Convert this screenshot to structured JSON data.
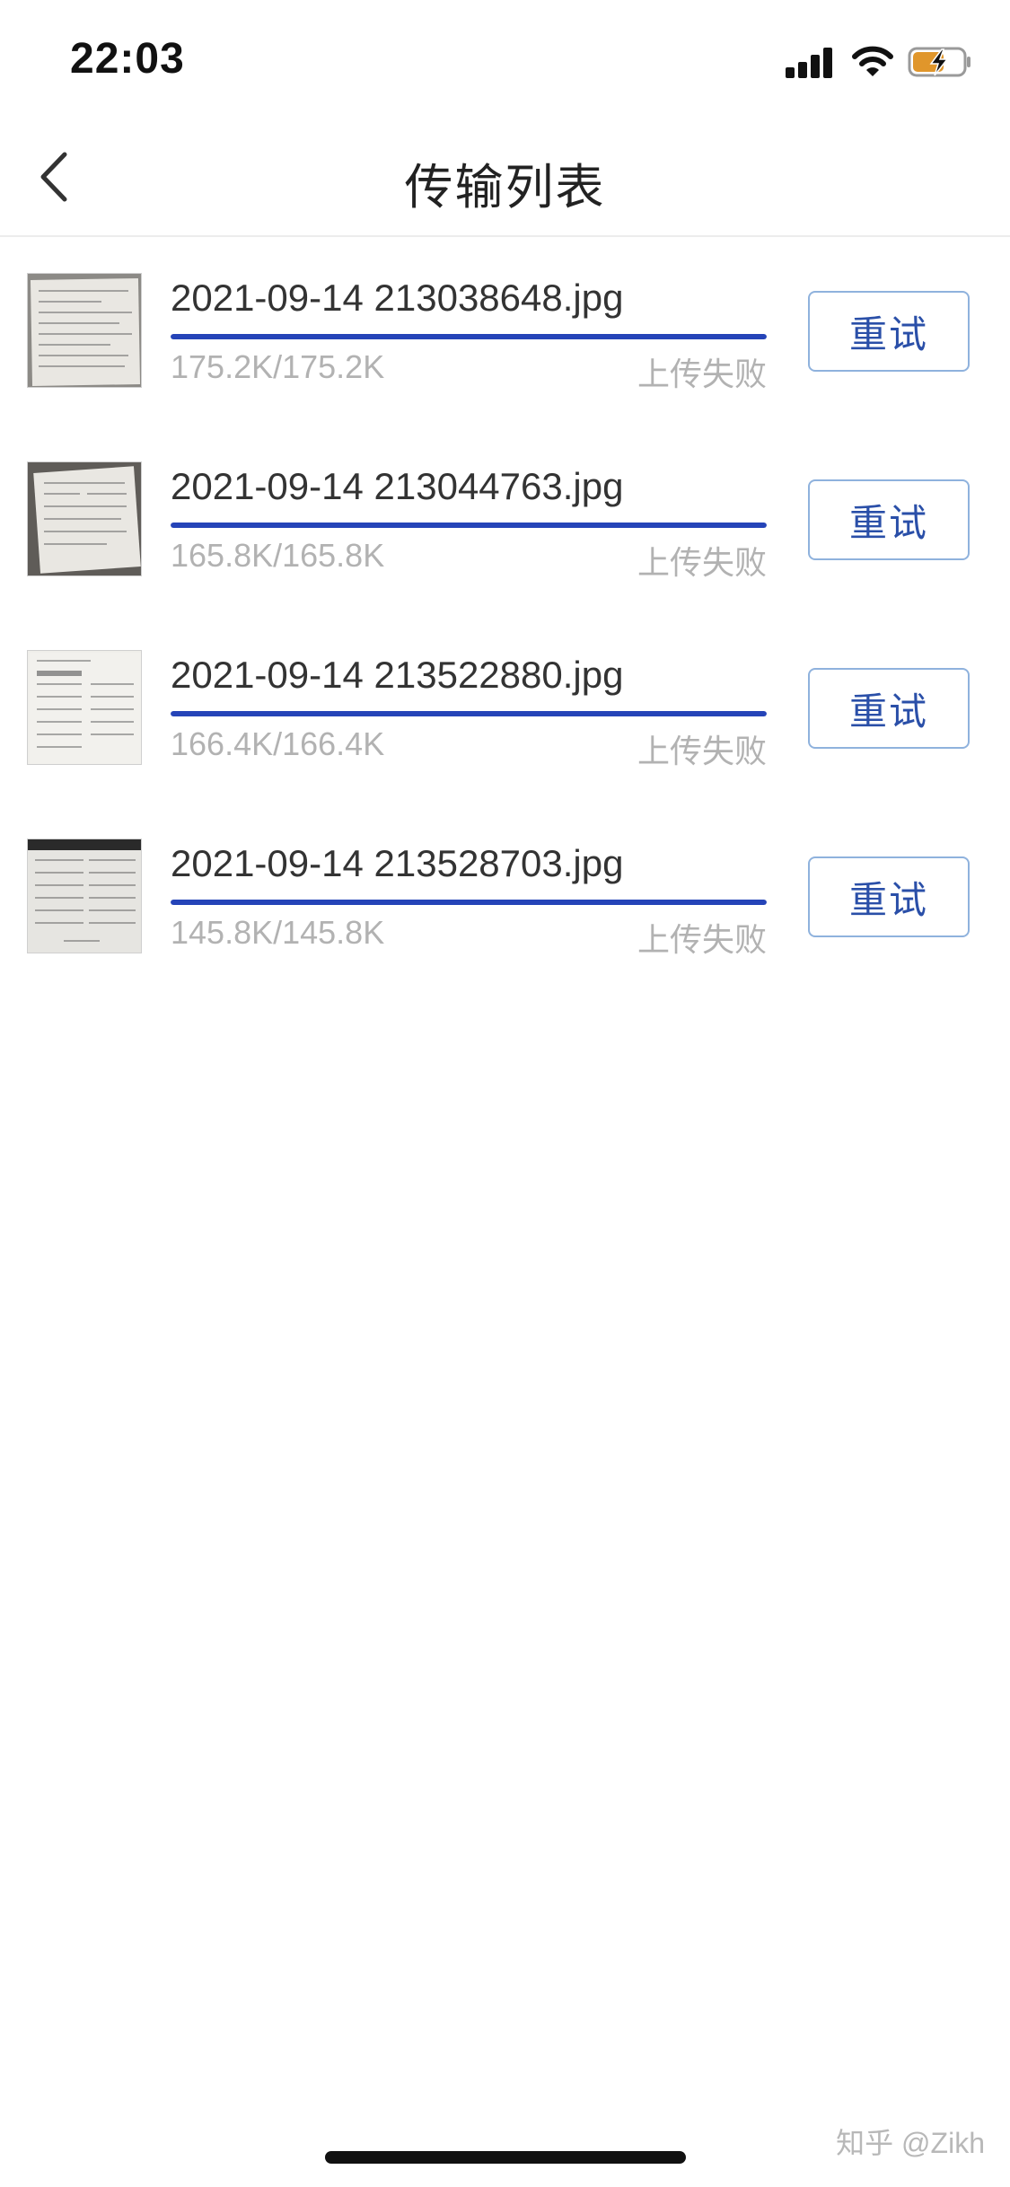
{
  "status_bar": {
    "time": "22:03",
    "signal_icon": "cellular-signal-icon",
    "wifi_icon": "wifi-icon",
    "battery_icon": "battery-charging-icon",
    "battery_color": "#e0962b"
  },
  "header": {
    "back_icon": "chevron-left-icon",
    "title": "传输列表"
  },
  "colors": {
    "progress": "#2544b8",
    "button_border": "#8fb2dd",
    "button_text": "#2a4fa8",
    "muted_text": "#b2b2b2"
  },
  "transfers": [
    {
      "file_name": "2021-09-14 213038648.jpg",
      "size": "175.2K/175.2K",
      "status": "上传失败",
      "action": "重试",
      "progress": 1.0,
      "thumbnail": "document-photo"
    },
    {
      "file_name": "2021-09-14 213044763.jpg",
      "size": "165.8K/165.8K",
      "status": "上传失败",
      "action": "重试",
      "progress": 1.0,
      "thumbnail": "document-photo"
    },
    {
      "file_name": "2021-09-14 213522880.jpg",
      "size": "166.4K/166.4K",
      "status": "上传失败",
      "action": "重试",
      "progress": 1.0,
      "thumbnail": "document-photo"
    },
    {
      "file_name": "2021-09-14 213528703.jpg",
      "size": "145.8K/145.8K",
      "status": "上传失败",
      "action": "重试",
      "progress": 1.0,
      "thumbnail": "document-photo"
    }
  ],
  "watermark": "知乎 @Zikh"
}
